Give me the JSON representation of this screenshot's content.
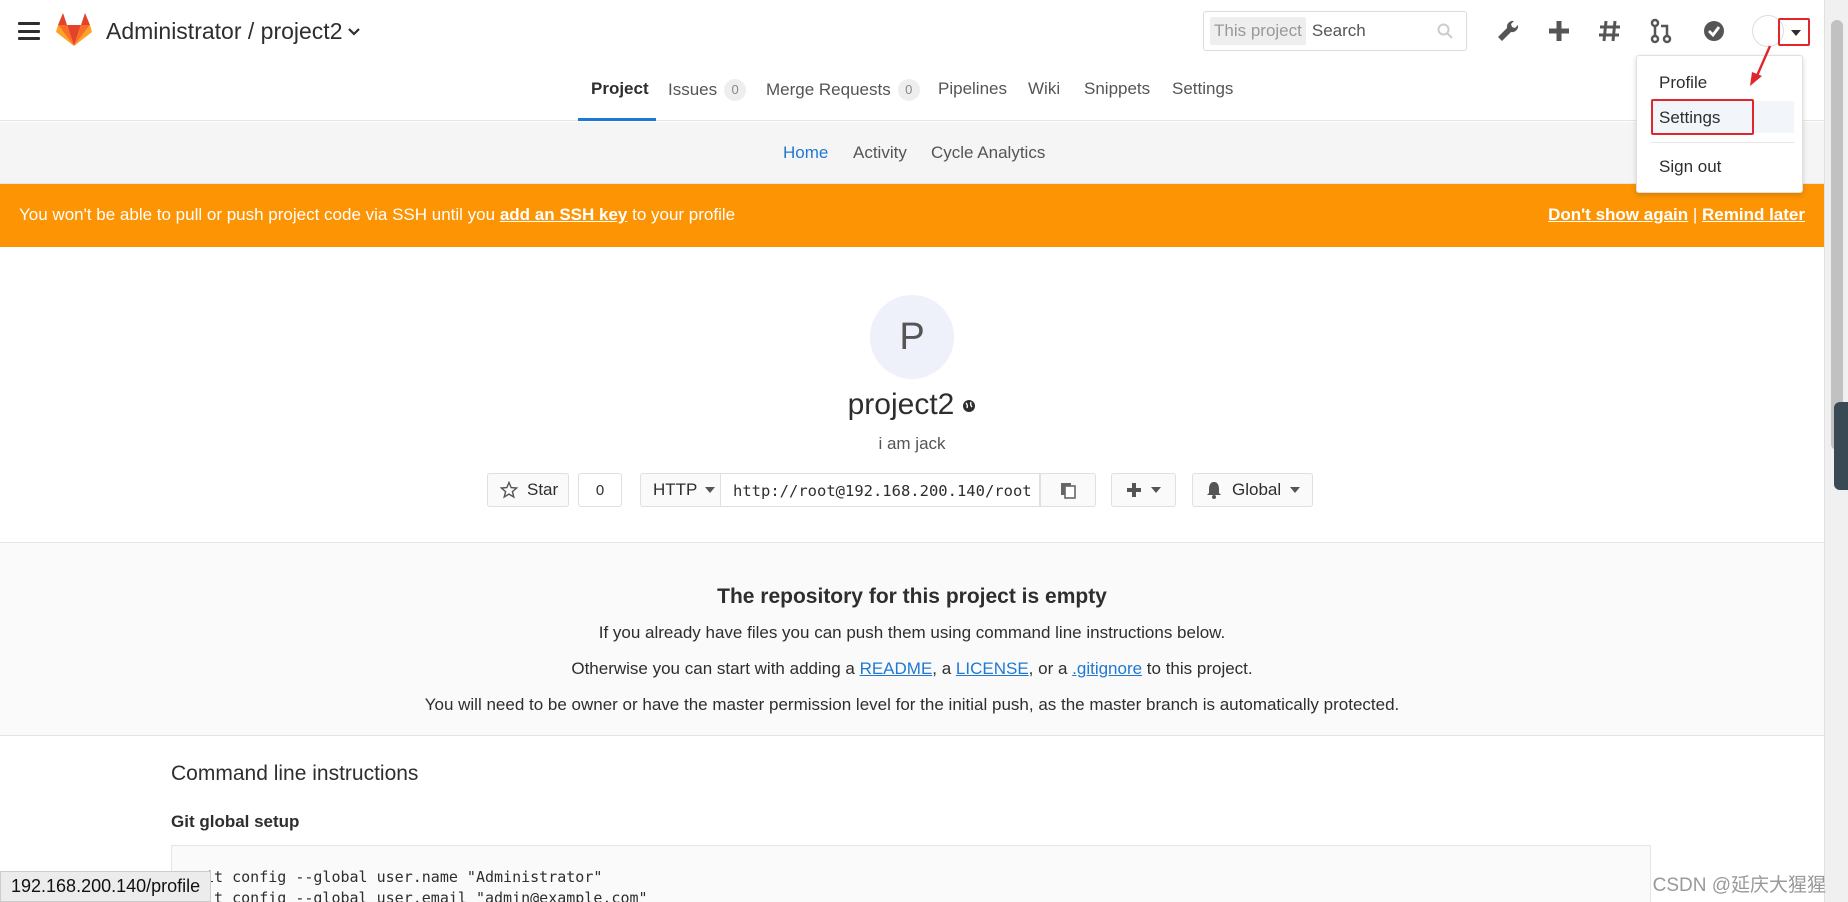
{
  "header": {
    "breadcrumb": "Administrator / project2",
    "search_scope": "This project",
    "search_placeholder": "Search"
  },
  "dropdown": {
    "profile": "Profile",
    "settings": "Settings",
    "signout": "Sign out"
  },
  "nav": {
    "project": "Project",
    "issues": "Issues",
    "issues_count": "0",
    "merge_requests": "Merge Requests",
    "merge_requests_count": "0",
    "pipelines": "Pipelines",
    "wiki": "Wiki",
    "snippets": "Snippets",
    "settings": "Settings"
  },
  "subnav": {
    "home": "Home",
    "activity": "Activity",
    "cycle_analytics": "Cycle Analytics"
  },
  "banner": {
    "pre": "You won't be able to pull or push project code via SSH until you ",
    "link": "add an SSH key",
    "post": " to your profile",
    "dont_show": "Don't show again",
    "sep": " | ",
    "remind": "Remind later"
  },
  "project": {
    "avatar_letter": "P",
    "name": "project2",
    "description": "i am jack",
    "star_label": "Star",
    "star_count": "0",
    "protocol": "HTTP",
    "clone_url": "http://root@192.168.200.140/root",
    "notification": "Global"
  },
  "empty": {
    "heading": "The repository for this project is empty",
    "line1": "If you already have files you can push them using command line instructions below.",
    "line2_pre": "Otherwise you can start with adding a ",
    "readme": "README",
    "line2_a": ", a ",
    "license": "LICENSE",
    "line2_b": ", or a ",
    "gitignore": ".gitignore",
    "line2_post": " to this project.",
    "line3": "You will need to be owner or have the master permission level for the initial push, as the master branch is automatically protected."
  },
  "cli": {
    "title": "Command line instructions",
    "git_global": "Git global setup",
    "line1": "git config --global user.name \"Administrator\"",
    "line2": "git config --global user.email \"admin@example.com\""
  },
  "status_url": "192.168.200.140/profile",
  "watermark": "CSDN @延庆大猩猩",
  "colors": {
    "accent": "#1f78d1",
    "banner": "#fc9403",
    "annotation": "#e0262c"
  }
}
